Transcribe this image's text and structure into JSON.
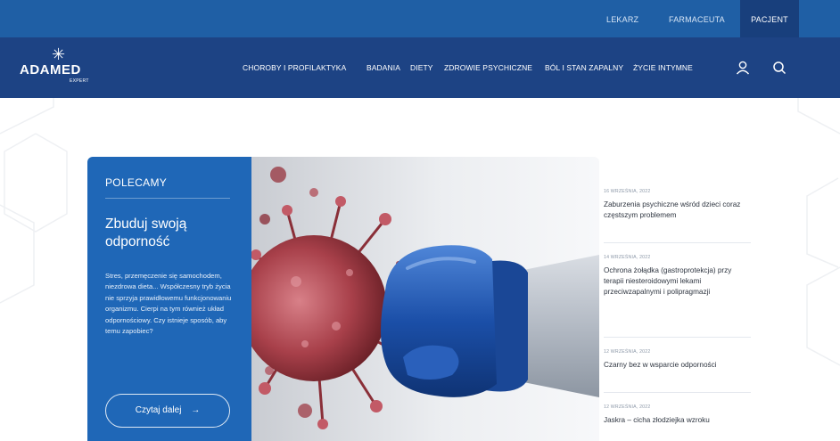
{
  "topbar": {
    "roles": [
      {
        "label": "Lekarz",
        "active": false
      },
      {
        "label": "Farmaceuta",
        "active": false
      },
      {
        "label": "Pacjent",
        "active": true
      }
    ]
  },
  "brand": {
    "name": "ADAMED",
    "sub": "EXPERT"
  },
  "nav": {
    "items": [
      "Choroby i profilaktyka",
      "Badania",
      "Diety",
      "Zdrowie psychiczne",
      "Ból i stan zapalny",
      "Życie intymne"
    ],
    "icons": [
      "user-icon",
      "search-icon"
    ]
  },
  "feature": {
    "eyebrow": "POLECAMY",
    "title": "Zbuduj swoją odporność",
    "description": "Stres, przemęczenie się samochodem, niezdrowa dieta... Współczesny tryb życia nie sprzyja prawidłowemu funkcjonowaniu organizmu. Cierpi na tym również układ odpornościowy. Czy istnieje sposób, aby temu zapobiec?",
    "button_label": "Czytaj dalej",
    "button_arrow": "→"
  },
  "news": [
    {
      "date": "16 września, 2022",
      "title": "Zaburzenia psychiczne wśród dzieci coraz częstszym problemem"
    },
    {
      "date": "14 września, 2022",
      "title": "Ochrona żołądka (gastroprotekcja) przy terapii niesteroidowymi lekami przeciwzapalnymi i polipragmazji"
    },
    {
      "date": "12 września, 2022",
      "title": "Czarny bez w wsparcie odporności"
    },
    {
      "date": "12 września, 2022",
      "title": "Jaskra – cicha złodziejka wzroku"
    }
  ],
  "colors": {
    "topbar": "#1f5fa5",
    "navbar": "#1d4384",
    "active_role": "#183f7c",
    "feature_panel": "#1f67b7",
    "glove": "#1b4fa8",
    "virus": "#a8404a"
  }
}
